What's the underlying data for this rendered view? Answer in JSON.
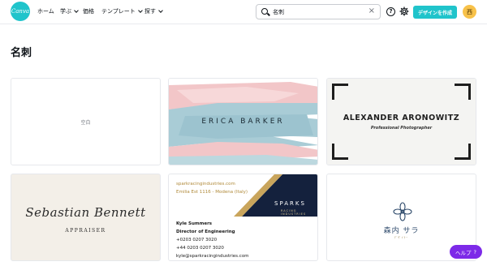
{
  "header": {
    "logo_text": "Canva",
    "nav": [
      {
        "label": "ホーム",
        "has_dropdown": false
      },
      {
        "label": "学ぶ",
        "has_dropdown": true
      },
      {
        "label": "価格",
        "has_dropdown": false
      },
      {
        "label": "テンプレート",
        "has_dropdown": true
      },
      {
        "label": "探す",
        "has_dropdown": true
      }
    ],
    "search": {
      "value": "名刺",
      "clear_icon": "close-icon"
    },
    "help_icon_glyph": "?",
    "create_button_label": "デザインを作成",
    "avatar_initial": "西"
  },
  "page": {
    "title": "名刺"
  },
  "templates": {
    "blank": {
      "label": "空白"
    },
    "erica": {
      "name": "ERICA BARKER"
    },
    "alexander": {
      "name": "ALEXANDER ARONOWITZ",
      "subtitle": "Professional Photographer"
    },
    "sebastian": {
      "name": "Sebastian Bennett",
      "role": "APPRAISER"
    },
    "sparks": {
      "website": "sparkracingindustries.com",
      "address": "Emilia Est 1116 - Modena (Italy)",
      "brand": "SPARKS",
      "brand_sub": "RACING INDUSTRIES",
      "contact_name": "Kyle Summers",
      "contact_title": "Director of Engineering",
      "phone1": "+0203 0207 3020",
      "phone2": "+44 0203 0207 3020",
      "email": "kyle@sparkracingindustries.com"
    },
    "mori": {
      "name": "森内 サラ",
      "sub": "ﾃﾞｻﾞｲﾅｰ"
    }
  },
  "help_button": {
    "label": "ヘルプ",
    "glyph": "?"
  },
  "colors": {
    "brand_teal": "#20c4cb",
    "help_purple": "#7d2ae8",
    "avatar_yellow": "#f8c24a"
  }
}
